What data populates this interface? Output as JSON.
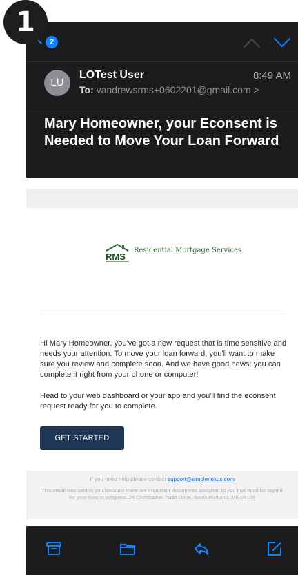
{
  "step_badge": "1",
  "topbar": {
    "unread_count": "2",
    "icons": [
      "back-chevron-icon",
      "chevron-up-icon",
      "chevron-down-icon"
    ]
  },
  "message": {
    "avatar_initials": "LU",
    "sender": "LOTest User",
    "time": "8:49 AM",
    "to_label": "To:",
    "to_address": "vandrewsrms+0602201@gmail.com",
    "to_chevron": ">",
    "subject": "Mary Homeowner, your Econsent is Needed to Move Your Loan Forward"
  },
  "email": {
    "logo_mark": "RMS",
    "logo_text": "Residential Mortgage Services",
    "paragraph1": "Hi Mary Homeowner, you've got a new request that is time sensitive and needs your attention. To move your loan forward, you'll want to make sure you review and complete soon. And we have good news: you can complete it right from your phone or computer!",
    "paragraph2": "Head to your web dashboard or your app and you'll find the econsent request ready for you to complete.",
    "cta_label": "GET STARTED",
    "help_prefix": "If you need help please contact ",
    "help_email": "support@simplenexus.com",
    "legal_text": "This email was sent to you because there are important documents assigned to you that must be signed for your loan to progress. ",
    "legal_address": "24 Christopher Toppi Drive, South Portland, ME 04106"
  },
  "toolbar": {
    "icons": [
      "archive-icon",
      "folder-icon",
      "reply-icon",
      "compose-icon"
    ]
  },
  "colors": {
    "dark_bg": "#1c1c1e",
    "accent": "#0a84ff",
    "cta": "#1f3655",
    "logo_green": "#2e6b30"
  }
}
